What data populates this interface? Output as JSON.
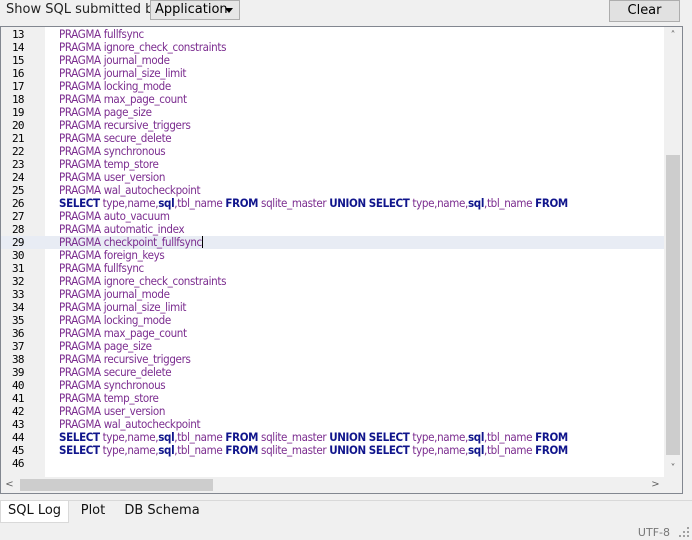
{
  "toolbar": {
    "show_label": "Show SQL submitted by",
    "source_select": "Application",
    "clear_button": "Clear"
  },
  "log_lines": [
    {
      "n": "13",
      "text": "PRAGMA fullfsync"
    },
    {
      "n": "14",
      "text": "PRAGMA ignore_check_constraints"
    },
    {
      "n": "15",
      "text": "PRAGMA journal_mode"
    },
    {
      "n": "16",
      "text": "PRAGMA journal_size_limit"
    },
    {
      "n": "17",
      "text": "PRAGMA locking_mode"
    },
    {
      "n": "18",
      "text": "PRAGMA max_page_count"
    },
    {
      "n": "19",
      "text": "PRAGMA page_size"
    },
    {
      "n": "20",
      "text": "PRAGMA recursive_triggers"
    },
    {
      "n": "21",
      "text": "PRAGMA secure_delete"
    },
    {
      "n": "22",
      "text": "PRAGMA synchronous"
    },
    {
      "n": "23",
      "text": "PRAGMA temp_store"
    },
    {
      "n": "24",
      "text": "PRAGMA user_version"
    },
    {
      "n": "25",
      "text": "PRAGMA wal_autocheckpoint"
    },
    {
      "n": "26",
      "text": "SELECT type,name,sql,tbl_name FROM sqlite_master UNION SELECT type,name,sql,tbl_name FROM",
      "select": true
    },
    {
      "n": "27",
      "text": "PRAGMA auto_vacuum"
    },
    {
      "n": "28",
      "text": "PRAGMA automatic_index"
    },
    {
      "n": "29",
      "text": "PRAGMA checkpoint_fullfsync",
      "highlight": true
    },
    {
      "n": "30",
      "text": "PRAGMA foreign_keys"
    },
    {
      "n": "31",
      "text": "PRAGMA fullfsync"
    },
    {
      "n": "32",
      "text": "PRAGMA ignore_check_constraints"
    },
    {
      "n": "33",
      "text": "PRAGMA journal_mode"
    },
    {
      "n": "34",
      "text": "PRAGMA journal_size_limit"
    },
    {
      "n": "35",
      "text": "PRAGMA locking_mode"
    },
    {
      "n": "36",
      "text": "PRAGMA max_page_count"
    },
    {
      "n": "37",
      "text": "PRAGMA page_size"
    },
    {
      "n": "38",
      "text": "PRAGMA recursive_triggers"
    },
    {
      "n": "39",
      "text": "PRAGMA secure_delete"
    },
    {
      "n": "40",
      "text": "PRAGMA synchronous"
    },
    {
      "n": "41",
      "text": "PRAGMA temp_store"
    },
    {
      "n": "42",
      "text": "PRAGMA user_version"
    },
    {
      "n": "43",
      "text": "PRAGMA wal_autocheckpoint"
    },
    {
      "n": "44",
      "text": "SELECT type,name,sql,tbl_name FROM sqlite_master UNION SELECT type,name,sql,tbl_name FROM",
      "select": true
    },
    {
      "n": "45",
      "text": "SELECT type,name,sql,tbl_name FROM sqlite_master UNION SELECT type,name,sql,tbl_name FROM",
      "select": true
    },
    {
      "n": "46",
      "text": ""
    }
  ],
  "tabs": [
    {
      "label": "SQL Log",
      "active": true
    },
    {
      "label": "Plot",
      "active": false
    },
    {
      "label": "DB Schema",
      "active": false
    }
  ],
  "status": {
    "encoding": "UTF-8"
  },
  "icons": {
    "scroll_up": "chevron-up-icon",
    "scroll_down": "chevron-down-icon",
    "scroll_left": "chevron-left-icon",
    "scroll_right": "chevron-right-icon",
    "dropdown": "caret-down-icon"
  }
}
